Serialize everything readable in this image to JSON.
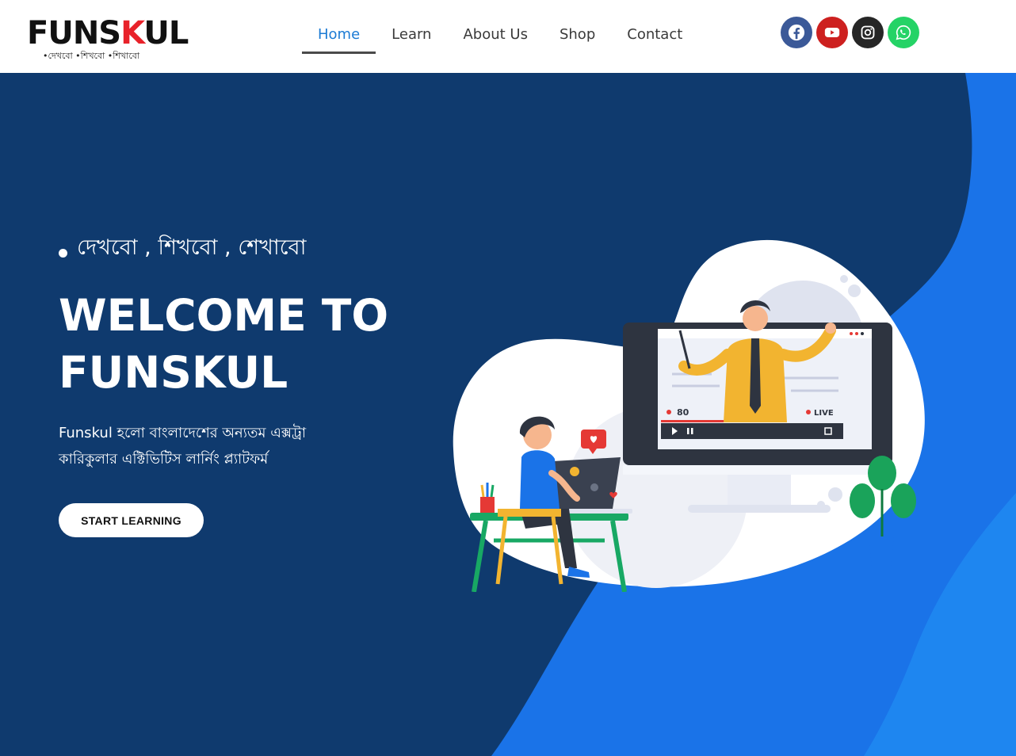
{
  "brand": {
    "logo_text_start": "FU",
    "logo_text_mid": "N",
    "logo_text_s": "S",
    "logo_text_k": "K",
    "logo_text_end": "UL",
    "logo_tagline": "•দেখবো  •শিখবো  •শিখাবো"
  },
  "nav": {
    "items": [
      {
        "label": "Home",
        "active": true
      },
      {
        "label": "Learn",
        "active": false
      },
      {
        "label": "About Us",
        "active": false
      },
      {
        "label": "Shop",
        "active": false
      },
      {
        "label": "Contact",
        "active": false
      }
    ]
  },
  "social": [
    {
      "name": "facebook-icon",
      "color": "#3b5998"
    },
    {
      "name": "youtube-icon",
      "color": "#cd201f"
    },
    {
      "name": "instagram-icon",
      "color": "#262626"
    },
    {
      "name": "whatsapp-icon",
      "color": "#25d366"
    }
  ],
  "hero": {
    "tagline": "দেখবো , শিখবো , শেখাবো",
    "title_line1": "WELCOME TO",
    "title_line2": "FUNSKUL",
    "description": "Funskul  হলো বাংলাদেশের অন্যতম এক্সট্রা কারিকুলার এক্টিভিটিস লার্নিং প্ল্যাটফর্ম",
    "cta_label": "START LEARNING"
  },
  "illustration": {
    "viewer_count": "80",
    "live_label": "LIVE"
  },
  "colors": {
    "nav_active": "#1c7bd4",
    "hero_dark": "#0f3a6e",
    "hero_blue": "#1a73e8"
  }
}
